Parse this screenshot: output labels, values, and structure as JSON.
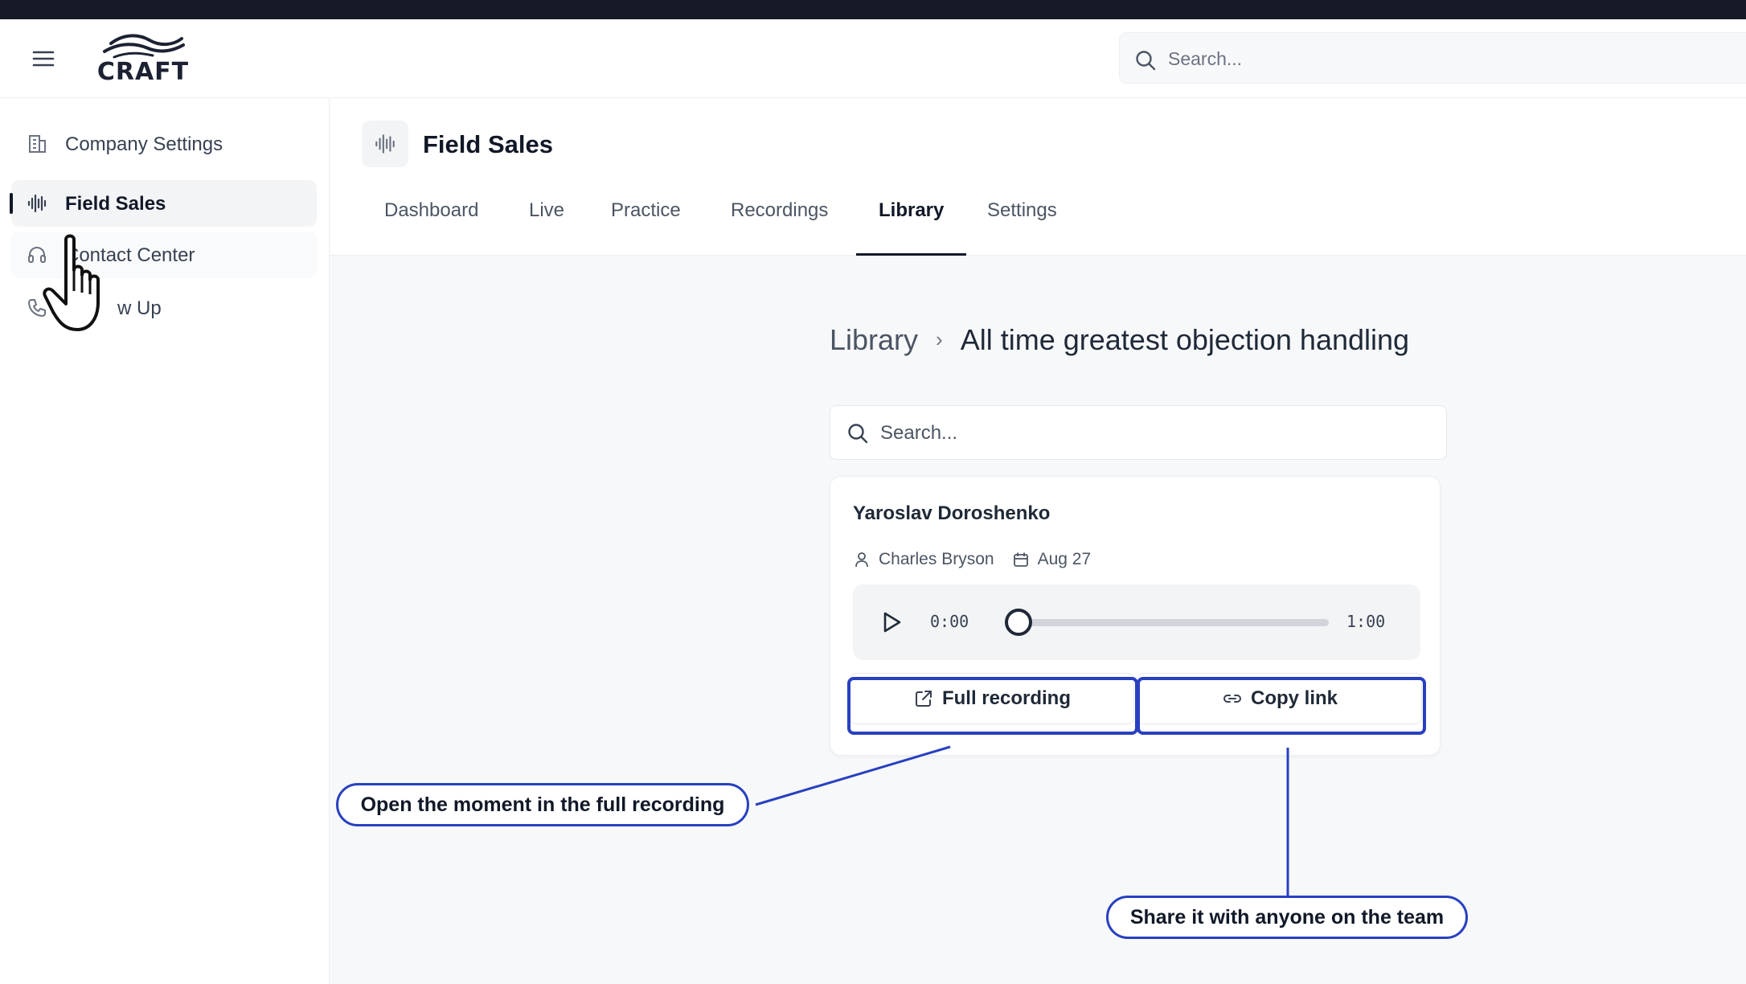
{
  "app": {
    "logo_text": "CRAFT",
    "search_placeholder": "Search..."
  },
  "sidebar": {
    "items": [
      {
        "label": "Company Settings",
        "icon": "building-icon",
        "active": false
      },
      {
        "label": "Field Sales",
        "icon": "waveform-icon",
        "active": true
      },
      {
        "label": "Contact Center",
        "icon": "headset-icon",
        "active": false
      },
      {
        "label": "w Up",
        "icon": "phone-icon",
        "active": false
      }
    ]
  },
  "page": {
    "title": "Field Sales",
    "tabs": [
      {
        "label": "Dashboard",
        "active": false
      },
      {
        "label": "Live",
        "active": false
      },
      {
        "label": "Practice",
        "active": false
      },
      {
        "label": "Recordings",
        "active": false
      },
      {
        "label": "Library",
        "active": true
      },
      {
        "label": "Settings",
        "active": false
      }
    ]
  },
  "breadcrumb": {
    "root": "Library",
    "separator": "›",
    "current": "All time greatest objection handling"
  },
  "library_search": {
    "placeholder": "Search..."
  },
  "card": {
    "title": "Yaroslav Doroshenko",
    "person": "Charles Bryson",
    "date": "Aug 27",
    "player": {
      "current_time": "0:00",
      "end_time": "1:00",
      "progress": 0.04
    },
    "buttons": {
      "full_recording": "Full recording",
      "copy_link": "Copy link"
    }
  },
  "callouts": {
    "full_recording": "Open the moment in the full recording",
    "copy_link": "Share it with anyone on the team"
  },
  "colors": {
    "annotation_blue": "#2840c0",
    "text_primary": "#111827",
    "surface": "#f7f8fa"
  }
}
